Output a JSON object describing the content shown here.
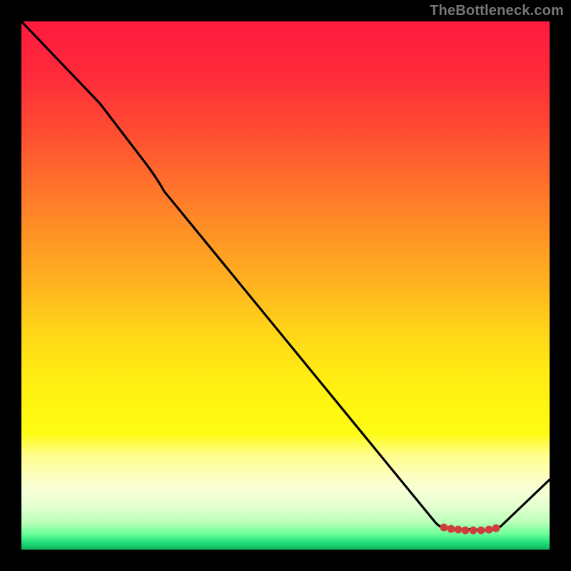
{
  "watermark": "TheBottleneck.com",
  "chart_data": {
    "type": "line",
    "title": "",
    "xlabel": "",
    "ylabel": "",
    "x": [
      0,
      0.15,
      0.24,
      0.27,
      0.78,
      0.8,
      0.89,
      0.91,
      1.0
    ],
    "values": [
      100,
      84,
      73,
      68,
      5,
      4,
      3.5,
      4.5,
      13
    ],
    "ylim": [
      0,
      100
    ],
    "xlim": [
      0,
      1
    ],
    "series": [
      {
        "name": "curve",
        "x": [
          0,
          0.15,
          0.24,
          0.27,
          0.78,
          0.8,
          0.89,
          0.91,
          1.0
        ],
        "values": [
          100,
          84,
          73,
          68,
          5,
          4,
          3.5,
          4.5,
          13
        ],
        "color": "#000000"
      }
    ],
    "markers": {
      "x": [
        0.8,
        0.813,
        0.827,
        0.841,
        0.856,
        0.87,
        0.886,
        0.899
      ],
      "values": [
        4.2,
        3.9,
        3.8,
        3.6,
        3.6,
        3.6,
        3.8,
        4.1
      ],
      "color": "#cf3e3c"
    },
    "background_gradient_colors": [
      "#ff1a3f",
      "#ffb41f",
      "#fff610",
      "#0fb560"
    ],
    "grid": false,
    "legend": false
  }
}
